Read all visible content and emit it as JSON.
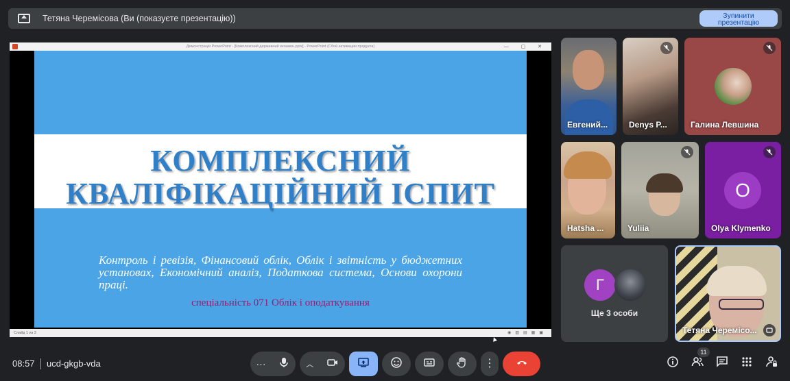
{
  "banner": {
    "title": "Тетяна Черемісова (Ви (показуєте презентацію))",
    "stop_line1": "Зупинити",
    "stop_line2": "презентацію"
  },
  "presentation": {
    "window_title": "Демонстрація PowerPoint - [Комплексний державний екзамен.pptx] - PowerPoint (Сбой активации продукта)",
    "slide_counter": "Слайд 1 из 3",
    "slide": {
      "title_line1": "КОМПЛЕКСНИЙ",
      "title_line2": "КВАЛІФІКАЦІЙНИЙ ІСПИТ",
      "body": "Контроль і ревізія, Фінансовий облік, Облік і звітність у бюджетних установах, Економічний аналіз, Податкова система, Основи охорони праці.",
      "specialty": "спеціальність 071 Облік і оподаткування"
    }
  },
  "participants": [
    {
      "name": "Евгений...",
      "muted": false
    },
    {
      "name": "Denys P...",
      "muted": true
    },
    {
      "name": "Галина Левшина",
      "muted": true
    },
    {
      "name": "Hatsha ...",
      "muted": false
    },
    {
      "name": "Yuliia",
      "muted": true
    },
    {
      "name": "Olya Klymenko",
      "muted": true,
      "initial": "O"
    },
    {
      "name": "Ще 3 особи",
      "initial": "Г"
    },
    {
      "name": "Тетяна Черемісо..."
    }
  ],
  "bottom": {
    "time": "08:57",
    "meeting_code": "ucd-gkgb-vda",
    "participants_count": "11"
  },
  "colors": {
    "background": "#202124",
    "accent": "#8ab4f8",
    "end_call": "#ea4335",
    "slide_blue": "#4ba4e6",
    "avatar_purple": "#7b1fa2"
  }
}
